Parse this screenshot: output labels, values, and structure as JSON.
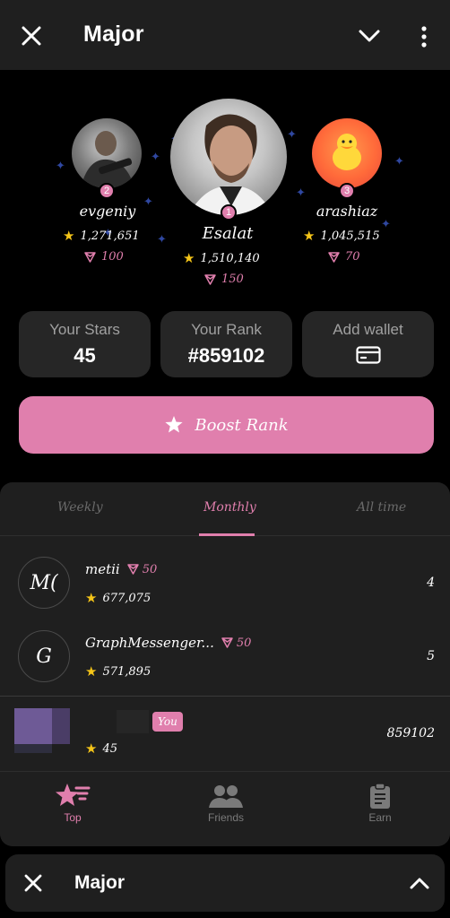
{
  "header": {
    "title": "Major"
  },
  "podium": {
    "second": {
      "badge": "2",
      "name": "evgeniy",
      "stars": "1,271,651",
      "gems": "100"
    },
    "first": {
      "badge": "1",
      "name": "Esalat",
      "stars": "1,510,140",
      "gems": "150"
    },
    "third": {
      "badge": "3",
      "name": "arashiaz",
      "stars": "1,045,515",
      "gems": "70"
    }
  },
  "cards": {
    "stars_label": "Your Stars",
    "stars_value": "45",
    "rank_label": "Your Rank",
    "rank_value": "#859102",
    "wallet_label": "Add wallet"
  },
  "boost": {
    "label": "Boost Rank"
  },
  "tabs": [
    {
      "label": "Weekly"
    },
    {
      "label": "Monthly"
    },
    {
      "label": "All time"
    }
  ],
  "leaderboard": [
    {
      "initials": "M(",
      "name": "metii",
      "gems": "50",
      "stars": "677,075",
      "rank": "4"
    },
    {
      "initials": "G",
      "name": "GraphMessenger...",
      "gems": "50",
      "stars": "571,895",
      "rank": "5"
    }
  ],
  "me": {
    "badge": "You",
    "stars": "45",
    "rank": "859102"
  },
  "nav": [
    {
      "label": "Top"
    },
    {
      "label": "Friends"
    },
    {
      "label": "Earn"
    }
  ],
  "minibar": {
    "title": "Major"
  },
  "colors": {
    "accent": "#e07fad",
    "surface": "#1f1f1f",
    "card": "#262626",
    "background": "#000000"
  }
}
